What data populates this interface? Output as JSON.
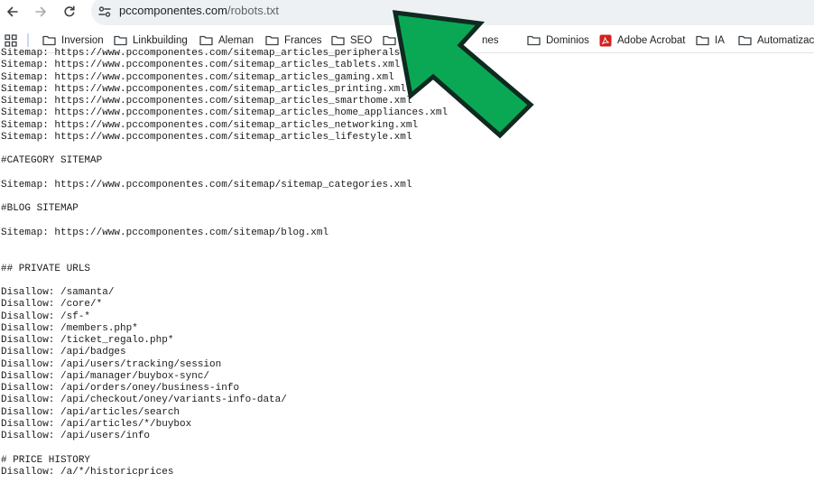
{
  "browser": {
    "url_domain": "pccomponentes.com",
    "url_path": "/robots.txt"
  },
  "bookmarks": [
    {
      "label": "Inversion",
      "type": "folder"
    },
    {
      "label": "Linkbuilding",
      "type": "folder"
    },
    {
      "label": "Aleman",
      "type": "folder"
    },
    {
      "label": "Frances",
      "type": "folder"
    },
    {
      "label": "SEO",
      "type": "folder"
    },
    {
      "label": "nes",
      "type": "folder"
    },
    {
      "label": "Dominios",
      "type": "folder"
    },
    {
      "label": "Adobe Acrobat",
      "type": "pdf"
    },
    {
      "label": "IA",
      "type": "folder"
    },
    {
      "label": "Automatizacio",
      "type": "folder"
    }
  ],
  "robots_lines": [
    "Sitemap: https://www.pccomponentes.com/sitemap_articles_peripherals.xml",
    "Sitemap: https://www.pccomponentes.com/sitemap_articles_tablets.xml",
    "Sitemap: https://www.pccomponentes.com/sitemap_articles_gaming.xml",
    "Sitemap: https://www.pccomponentes.com/sitemap_articles_printing.xml",
    "Sitemap: https://www.pccomponentes.com/sitemap_articles_smarthome.xml",
    "Sitemap: https://www.pccomponentes.com/sitemap_articles_home_appliances.xml",
    "Sitemap: https://www.pccomponentes.com/sitemap_articles_networking.xml",
    "Sitemap: https://www.pccomponentes.com/sitemap_articles_lifestyle.xml",
    "",
    "#CATEGORY SITEMAP",
    "",
    "Sitemap: https://www.pccomponentes.com/sitemap/sitemap_categories.xml",
    "",
    "#BLOG SITEMAP",
    "",
    "Sitemap: https://www.pccomponentes.com/sitemap/blog.xml",
    "",
    "",
    "## PRIVATE URLS",
    "",
    "Disallow: /samanta/",
    "Disallow: /core/*",
    "Disallow: /sf-*",
    "Disallow: /members.php*",
    "Disallow: /ticket_regalo.php*",
    "Disallow: /api/badges",
    "Disallow: /api/users/tracking/session",
    "Disallow: /api/manager/buybox-sync/",
    "Disallow: /api/orders/oney/business-info",
    "Disallow: /api/checkout/oney/variants-info-data/",
    "Disallow: /api/articles/search",
    "Disallow: /api/articles/*/buybox",
    "Disallow: /api/users/info",
    "",
    "# PRICE HISTORY",
    "Disallow: /a/*/historicprices"
  ],
  "colors": {
    "arrow_fill": "#0aa855",
    "arrow_stroke": "#0f2a1f",
    "omnibox_bg": "#eef1f4",
    "pdf_icon": "#d3201e"
  }
}
